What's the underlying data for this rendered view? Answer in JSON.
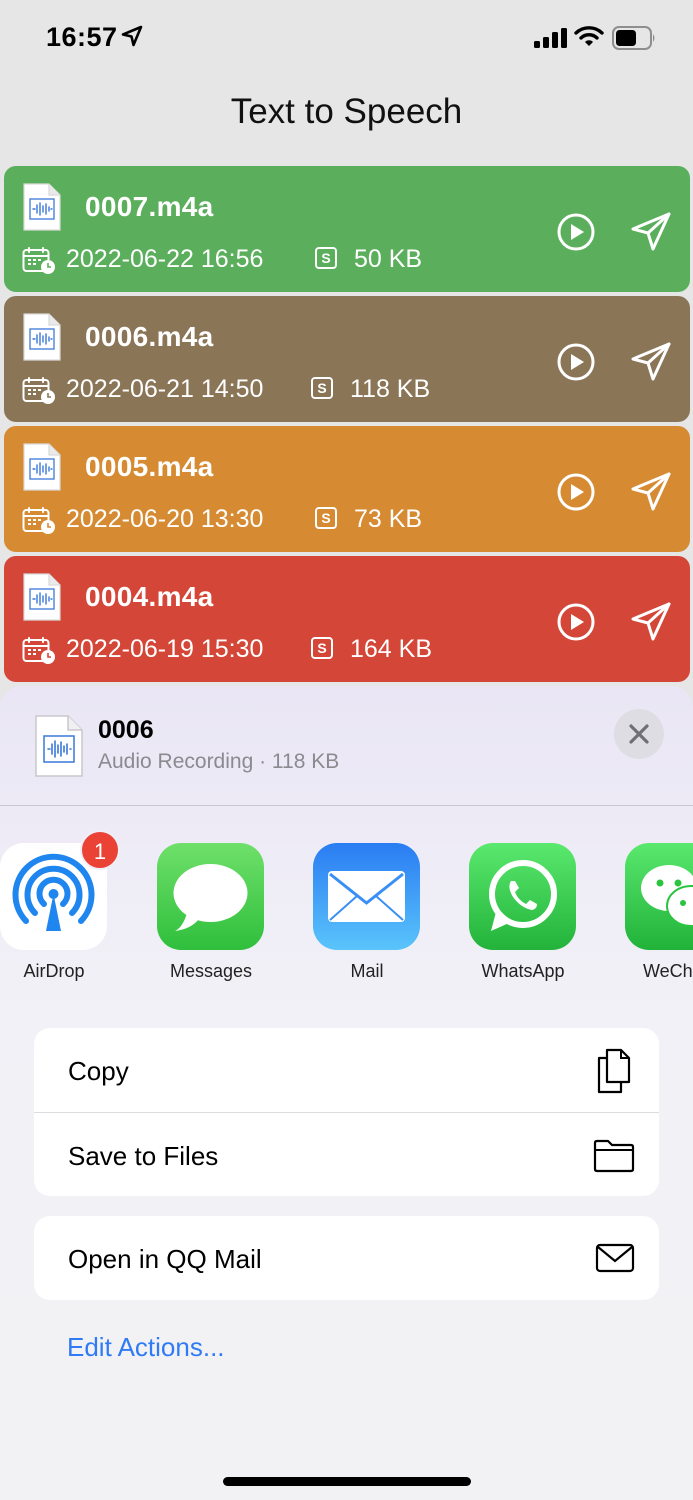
{
  "status": {
    "time": "16:57"
  },
  "app": {
    "title": "Text to Speech"
  },
  "files": [
    {
      "name": "0007.m4a",
      "date": "2022-06-22 16:56",
      "size": "50 KB",
      "color": "#5baf5c"
    },
    {
      "name": "0006.m4a",
      "date": "2022-06-21 14:50",
      "size": "118 KB",
      "color": "#8a7657"
    },
    {
      "name": "0005.m4a",
      "date": "2022-06-20 13:30",
      "size": "73 KB",
      "color": "#d68b32"
    },
    {
      "name": "0004.m4a",
      "date": "2022-06-19 15:30",
      "size": "164 KB",
      "color": "#d44738"
    }
  ],
  "share": {
    "file_name": "0006",
    "file_subtitle": "Audio Recording · 118 KB",
    "apps": [
      {
        "label": "AirDrop",
        "icon": "airdrop-icon",
        "badge": "1"
      },
      {
        "label": "Messages",
        "icon": "messages-icon"
      },
      {
        "label": "Mail",
        "icon": "mail-icon"
      },
      {
        "label": "WhatsApp",
        "icon": "whatsapp-icon"
      },
      {
        "label": "WeCh",
        "icon": "wechat-icon"
      }
    ],
    "actions": [
      {
        "label": "Copy",
        "icon": "copy-icon"
      },
      {
        "label": "Save to Files",
        "icon": "folder-icon"
      }
    ],
    "actions2": [
      {
        "label": "Open in QQ Mail",
        "icon": "envelope-icon"
      }
    ],
    "edit_actions": "Edit Actions..."
  }
}
